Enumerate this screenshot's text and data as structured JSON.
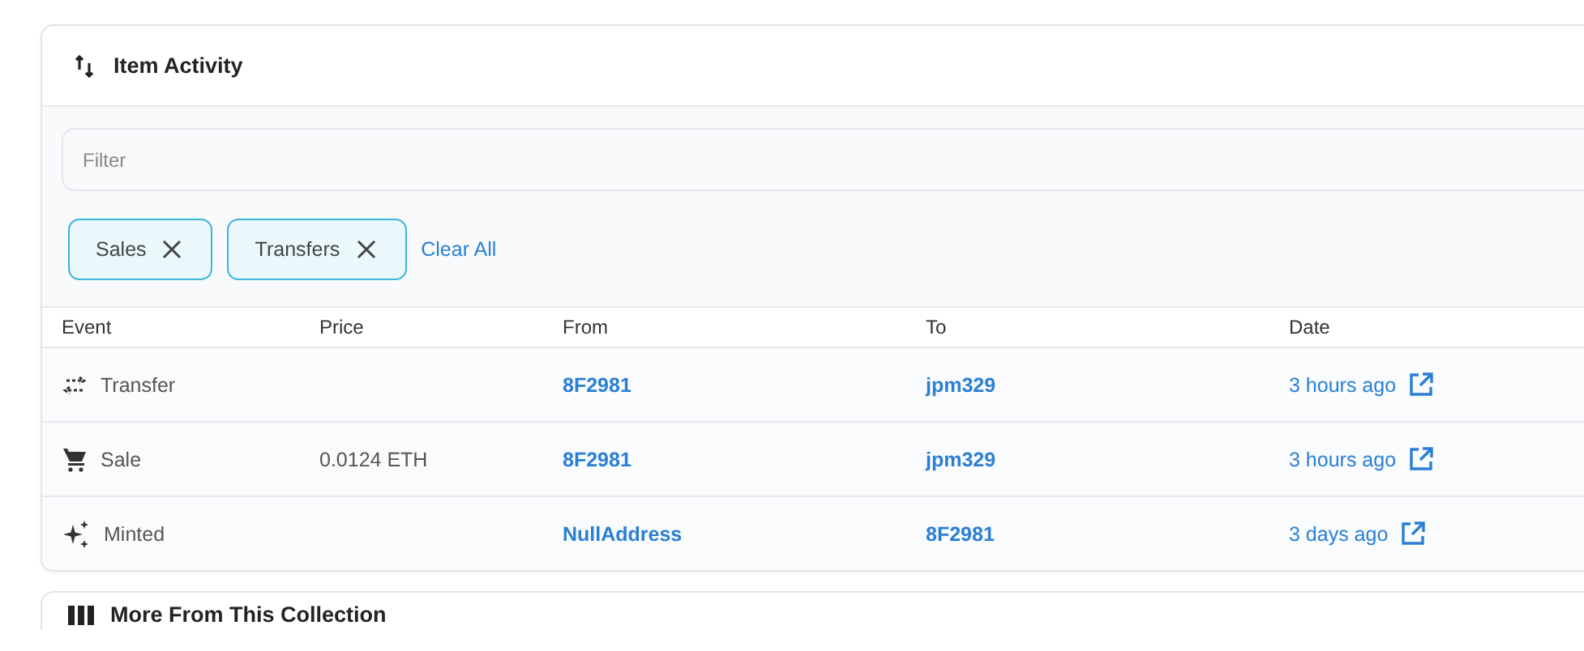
{
  "panel": {
    "title": "Item Activity"
  },
  "filter": {
    "placeholder": "Filter"
  },
  "chips": [
    {
      "label": "Sales"
    },
    {
      "label": "Transfers"
    }
  ],
  "clear_all": "Clear All",
  "table": {
    "columns": [
      "Event",
      "Price",
      "From",
      "To",
      "Date"
    ],
    "rows": [
      {
        "kind": "transfer",
        "event": "Transfer",
        "price": "",
        "from": "8F2981",
        "to": "jpm329",
        "date": "3 hours ago"
      },
      {
        "kind": "sale",
        "event": "Sale",
        "price": "0.0124 ETH",
        "from": "8F2981",
        "to": "jpm329",
        "date": "3 hours ago"
      },
      {
        "kind": "minted",
        "event": "Minted",
        "price": "",
        "from": "NullAddress",
        "to": "8F2981",
        "date": "3 days ago"
      }
    ]
  },
  "next_panel": {
    "title": "More From This Collection"
  }
}
